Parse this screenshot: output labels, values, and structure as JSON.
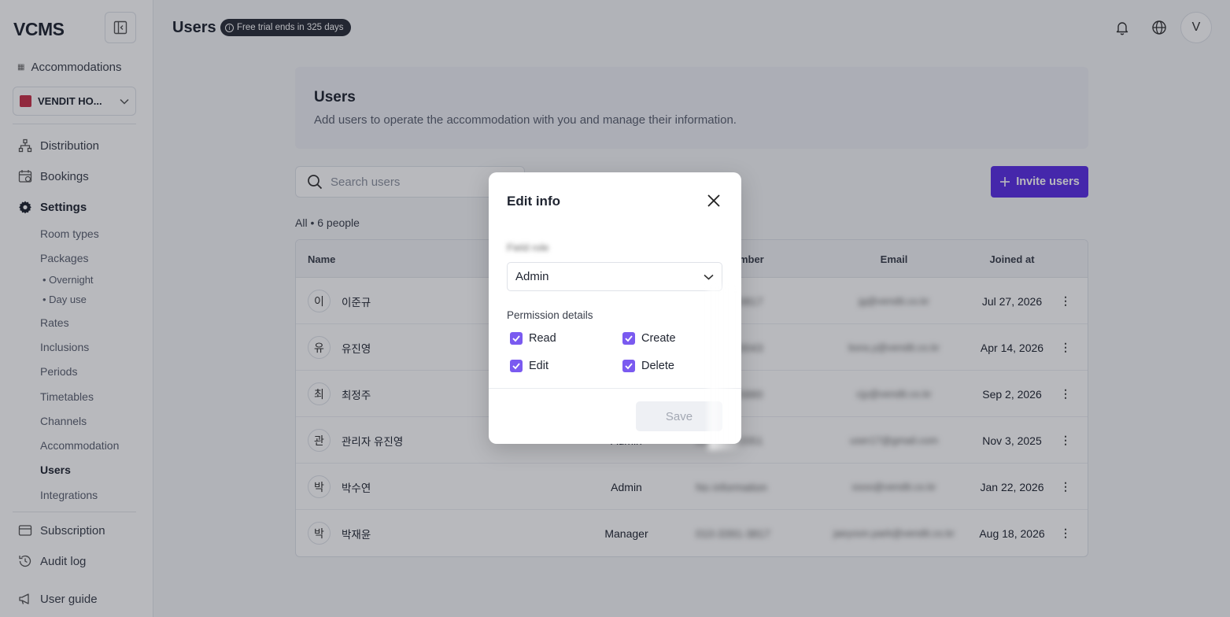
{
  "sidebar": {
    "logo": "VCMS",
    "accommodations_label": "Accommodations",
    "property": "VENDIT HO...",
    "nav": {
      "distribution": "Distribution",
      "bookings": "Bookings",
      "settings": "Settings",
      "subscription": "Subscription",
      "audit_log": "Audit log",
      "user_guide": "User guide"
    },
    "settings_items": {
      "room_types": "Room types",
      "packages": "Packages",
      "overnight": "Overnight",
      "day_use": "Day use",
      "rates": "Rates",
      "inclusions": "Inclusions",
      "periods": "Periods",
      "timetables": "Timetables",
      "channels": "Channels",
      "accommodation": "Accommodation",
      "users": "Users",
      "integrations": "Integrations"
    }
  },
  "topbar": {
    "title": "Users",
    "trial_badge": "Free trial ends in 325 days",
    "avatar_letter": "V"
  },
  "main": {
    "heading": "Users",
    "description": "Add users to operate the accommodation with you and manage their information.",
    "search_placeholder": "Search users",
    "invite_label": "Invite users",
    "count_label": "All • 6 people",
    "columns": {
      "name": "Name",
      "phone": "umber",
      "email": "Email",
      "joined": "Joined at"
    },
    "rows": [
      {
        "initial": "이",
        "name": "이준규",
        "role": "",
        "phone": "010-****-0817",
        "email": "jg@vendit.co.kr",
        "joined": "Jul 27, 2026"
      },
      {
        "initial": "유",
        "name": "유진영",
        "role": "",
        "phone": "010-****-3043",
        "email": "bora.y@vendit.co.kr",
        "joined": "Apr 14, 2026"
      },
      {
        "initial": "최",
        "name": "최정주",
        "role": "",
        "phone": "010-****-5880",
        "email": "cjy@vendit.co.kr",
        "joined": "Sep 2, 2026"
      },
      {
        "initial": "관",
        "name": "관리자 유진영",
        "role": "Admin",
        "phone": "010-****-2051",
        "email": "user17@gmail.com",
        "joined": "Nov 3, 2025"
      },
      {
        "initial": "박",
        "name": "박수연",
        "role": "Admin",
        "phone": "No information",
        "email": "ssoo@vendit.co.kr",
        "joined": "Jan 22, 2026"
      },
      {
        "initial": "박",
        "name": "박재윤",
        "role": "Manager",
        "phone": "010-3391-3817",
        "email": "jaeyoon.park@vendit.co.kr",
        "joined": "Aug 18, 2026"
      }
    ],
    "more_glyph": "⋮"
  },
  "modal": {
    "title": "Edit info",
    "field_label": "Field role",
    "role_value": "Admin",
    "permission_label": "Permission details",
    "permissions": {
      "read": "Read",
      "create": "Create",
      "edit": "Edit",
      "delete": "Delete"
    },
    "save_label": "Save"
  },
  "colors": {
    "accent": "#5b2ee6",
    "checkbox": "#7a5af0",
    "badge": "#2a2e38"
  }
}
